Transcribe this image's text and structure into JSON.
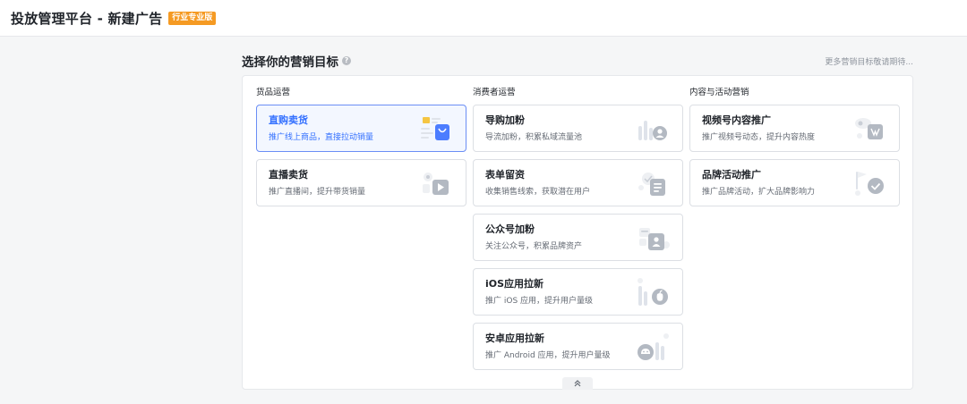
{
  "header": {
    "title": "投放管理平台 - 新建广告",
    "badge": "行业专业版"
  },
  "section": {
    "title": "选择你的营销目标",
    "more_link": "更多营销目标敬请期待..."
  },
  "colors": {
    "accent": "#3370ff",
    "badge": "#f59a23"
  },
  "columns": [
    {
      "title": "货品运营",
      "cards": [
        {
          "title": "直购卖货",
          "desc": "推广线上商品，直接拉动销量",
          "icon": "shopping-bag-icon",
          "selected": true
        },
        {
          "title": "直播卖货",
          "desc": "推广直播间，提升带货销量",
          "icon": "live-play-icon",
          "selected": false
        }
      ]
    },
    {
      "title": "消费者运营",
      "cards": [
        {
          "title": "导购加粉",
          "desc": "导流加粉，积累私域流量池",
          "icon": "add-fans-icon",
          "selected": false
        },
        {
          "title": "表单留资",
          "desc": "收集销售线索，获取潜在用户",
          "icon": "form-icon",
          "selected": false
        },
        {
          "title": "公众号加粉",
          "desc": "关注公众号，积累品牌资产",
          "icon": "official-account-icon",
          "selected": false
        },
        {
          "title": "iOS应用拉新",
          "desc": "推广 iOS 应用，提升用户量级",
          "icon": "apple-icon",
          "selected": false
        },
        {
          "title": "安卓应用拉新",
          "desc": "推广 Android 应用，提升用户量级",
          "icon": "android-icon",
          "selected": false
        }
      ]
    },
    {
      "title": "内容与活动营销",
      "cards": [
        {
          "title": "视频号内容推广",
          "desc": "推广视频号动态，提升内容热度",
          "icon": "channels-icon",
          "selected": false
        },
        {
          "title": "品牌活动推广",
          "desc": "推广品牌活动，扩大品牌影响力",
          "icon": "brand-event-icon",
          "selected": false
        }
      ]
    }
  ],
  "collapse_icon": "double-chevron-up-icon"
}
